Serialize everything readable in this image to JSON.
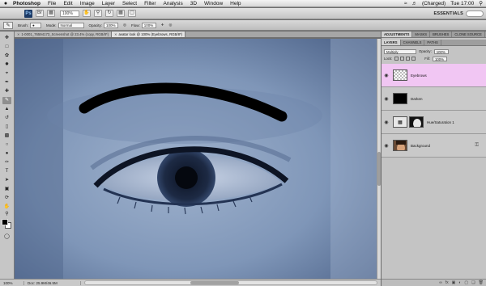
{
  "menubar": {
    "apple": "",
    "app_name": "Photoshop",
    "items": [
      "File",
      "Edit",
      "Image",
      "Layer",
      "Select",
      "Filter",
      "Analysis",
      "3D",
      "Window",
      "Help"
    ],
    "battery": "(Charged)",
    "clock": "Tue 17:00",
    "spotlight_icon": "magnifier-icon"
  },
  "appbar": {
    "logo": "Ps",
    "zoom": "100%",
    "workspace": "ESSENTIALS"
  },
  "options": {
    "brush_label": "Brush:",
    "mode_label": "Mode:",
    "mode_value": "Normal",
    "opacity_label": "Opacity:",
    "opacity_value": "100%",
    "flow_label": "Flow:",
    "flow_value": "100%"
  },
  "tabs": [
    {
      "label": "1-0001_76594173_Screenshot @ 23.4% (copy, RGB/8*)",
      "active": false
    },
    {
      "label": "avatar look @ 100% (Eyebrows, RGB/8*)",
      "active": true
    }
  ],
  "status": {
    "zoom": "100%",
    "doc": "Doc: 25.9M/46.5M"
  },
  "panel": {
    "top_tabs": [
      "ADJUSTMENTS",
      "MASKS",
      "BRUSHES",
      "CLONE SOURCE"
    ],
    "layer_tabs": [
      "LAYERS",
      "CHANNELS",
      "PATHS"
    ],
    "blend_mode": "Multiply",
    "opacity_label": "Opacity:",
    "opacity_value": "100%",
    "lock_label": "Lock:",
    "fill_label": "Fill:",
    "fill_value": "100%",
    "layers": [
      {
        "name": "Eyebrows",
        "selected": true
      },
      {
        "name": "Darken",
        "selected": false
      },
      {
        "name": "Hue/Saturation 1",
        "selected": false
      },
      {
        "name": "Background",
        "selected": false
      }
    ]
  },
  "colors": {
    "selected_layer": "#f1c6f3",
    "canvas_tint": "#8aa0bf",
    "brush_stroke": "#000000"
  }
}
